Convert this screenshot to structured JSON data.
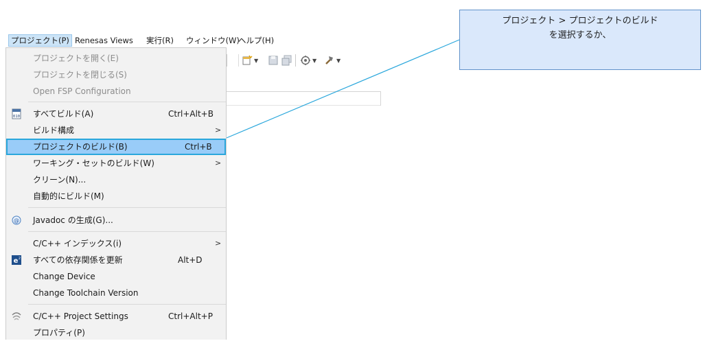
{
  "menubar": {
    "items": [
      {
        "label": "プロジェクト(P)"
      },
      {
        "label": "Renesas Views"
      },
      {
        "label": "実行(R)"
      },
      {
        "label": "ウィンドウ(W)"
      },
      {
        "label": "ヘルプ(H)"
      }
    ]
  },
  "dropdown": {
    "items": [
      {
        "label": "プロジェクトを開く(E)"
      },
      {
        "label": "プロジェクトを閉じる(S)"
      },
      {
        "label": "Open FSP Configuration"
      },
      {
        "label": "すべてビルド(A)",
        "shortcut": "Ctrl+Alt+B"
      },
      {
        "label": "ビルド構成"
      },
      {
        "label": "プロジェクトのビルド(B)",
        "shortcut": "Ctrl+B"
      },
      {
        "label": "ワーキング・セットのビルド(W)"
      },
      {
        "label": "クリーン(N)..."
      },
      {
        "label": "自動的にビルド(M)"
      },
      {
        "label": "Javadoc の生成(G)..."
      },
      {
        "label": "C/C++ インデックス(i)"
      },
      {
        "label": "すべての依存関係を更新",
        "shortcut": "Alt+D"
      },
      {
        "label": "Change Device"
      },
      {
        "label": "Change Toolchain Version"
      },
      {
        "label": "C/C++ Project Settings",
        "shortcut": "Ctrl+Alt+P"
      },
      {
        "label": "プロパティ(P)"
      }
    ]
  },
  "callout": {
    "line1": "プロジェクト > プロジェクトのビルド",
    "line2": "を選択するか、"
  },
  "colors": {
    "highlight": "#99ccf8",
    "highlight_border": "#2aa7dc",
    "callout_bg": "#dae8fb",
    "callout_border": "#5f91c9"
  }
}
